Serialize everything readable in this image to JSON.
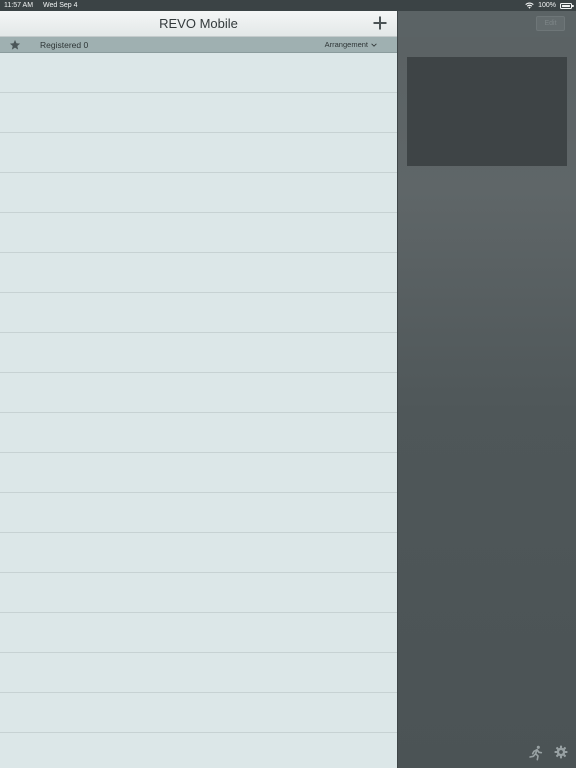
{
  "status_bar": {
    "time": "11:57 AM",
    "date": "Wed Sep 4",
    "battery": "100%"
  },
  "master": {
    "title": "REVO Mobile",
    "add_icon": "plus-icon",
    "filter": {
      "icon": "star-icon",
      "label": "Registered 0",
      "sort_label": "Arrangement",
      "sort_icon": "chevron-down-icon"
    },
    "rows": []
  },
  "detail": {
    "edit_label": "Edit",
    "bottom_icons": [
      "running-man-icon",
      "gear-icon"
    ]
  },
  "colors": {
    "list_background": "#dce7e8",
    "filter_bar": "#9fb0b1",
    "detail_background": "#4b5355",
    "status_bar": "#3b4345"
  }
}
